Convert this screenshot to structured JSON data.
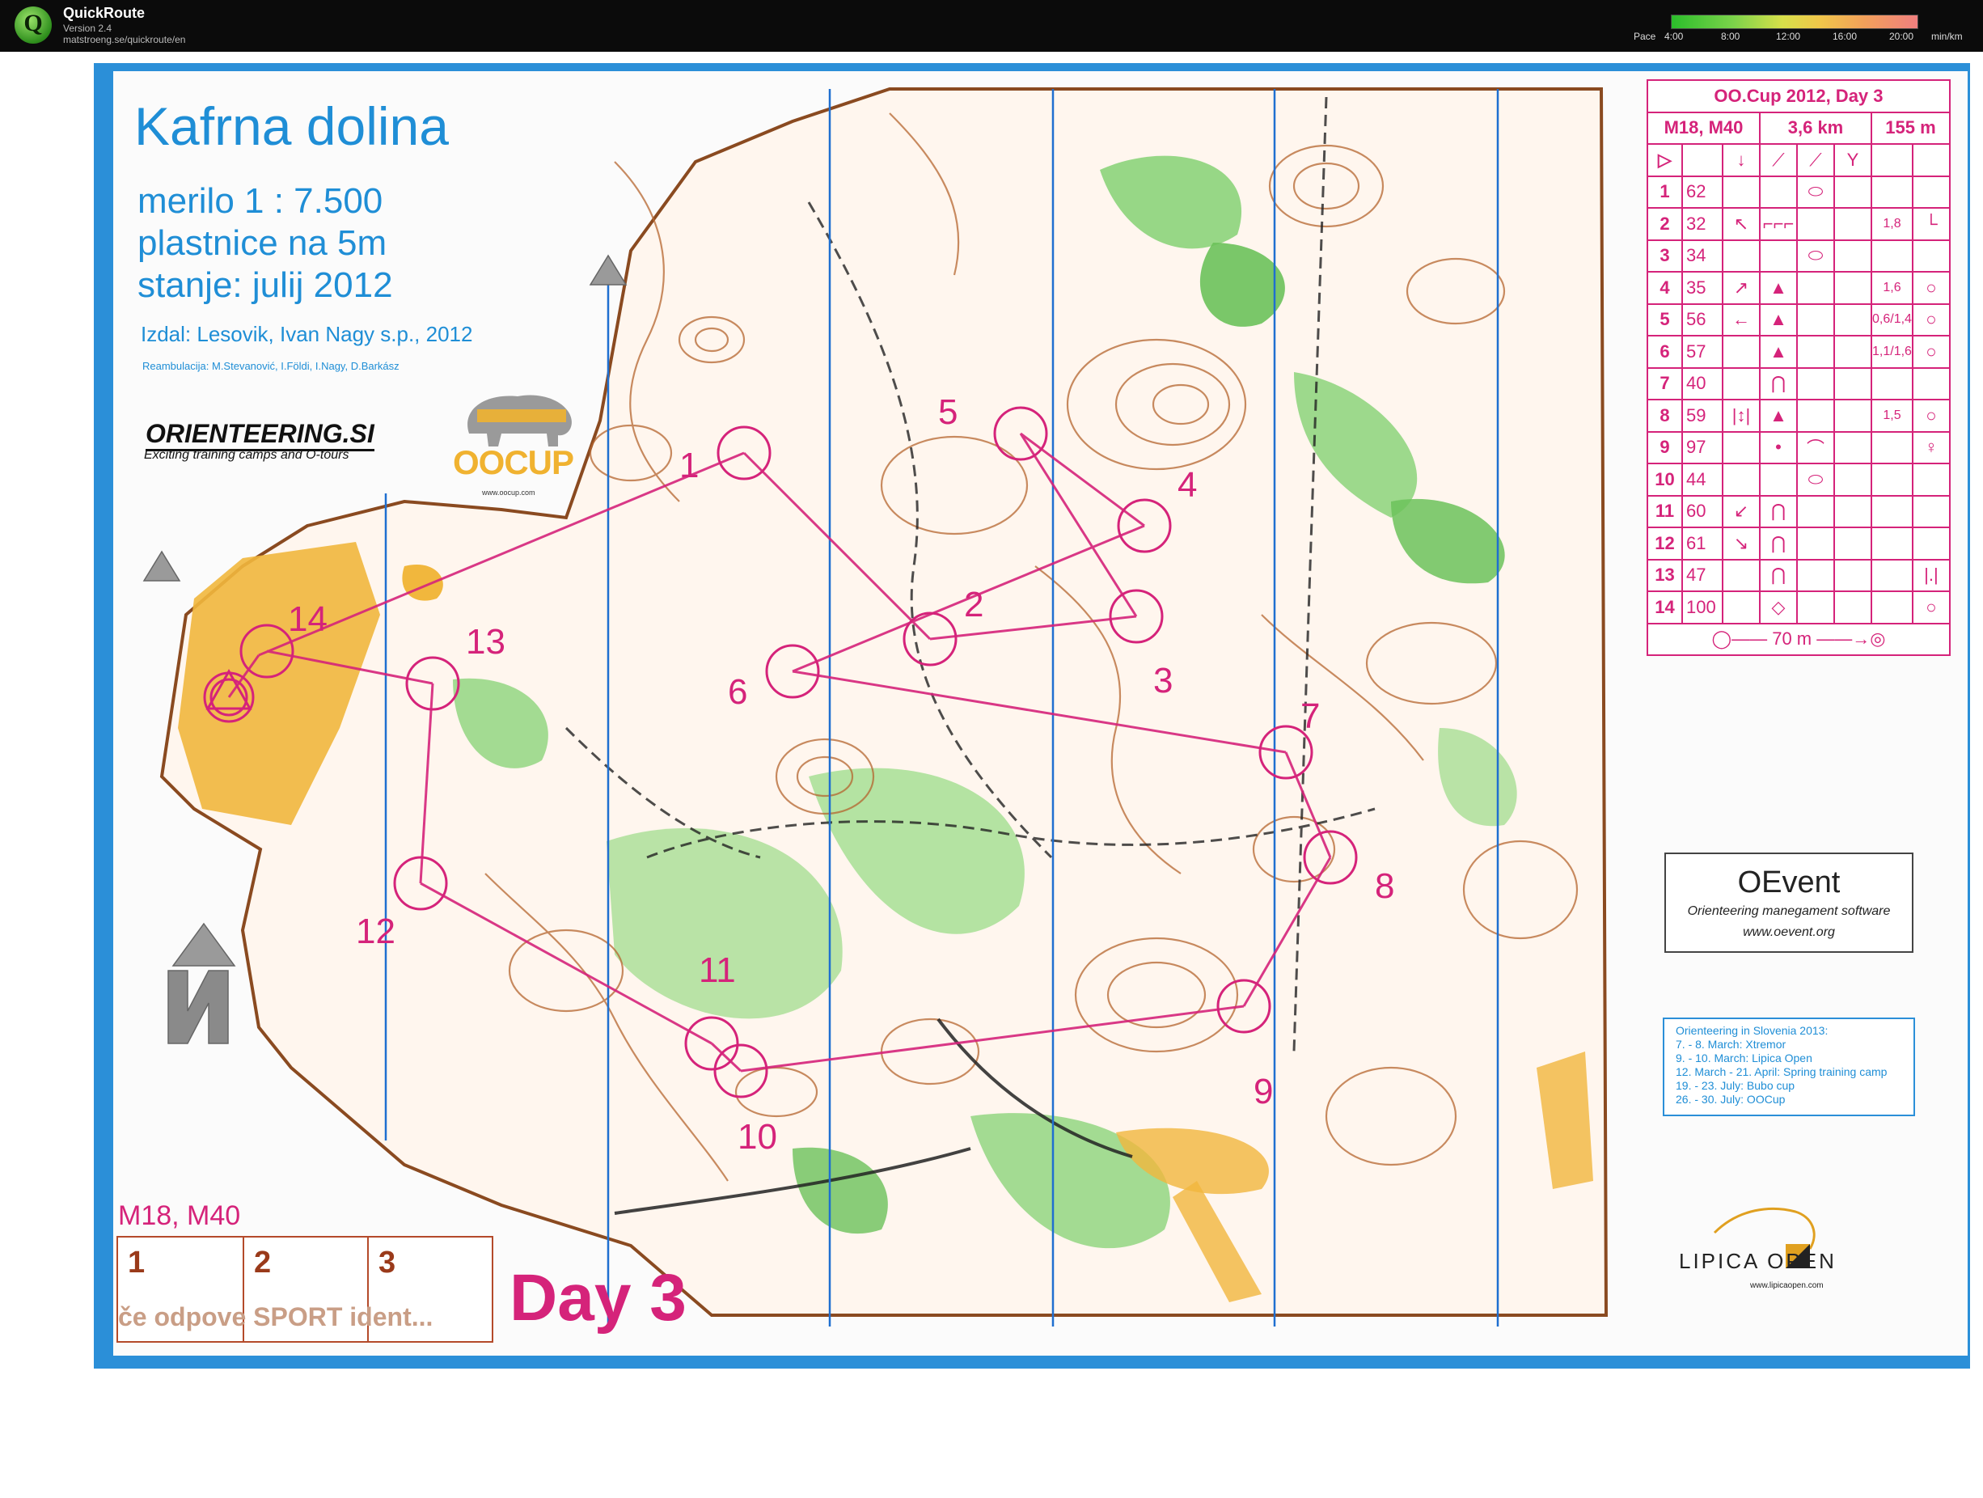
{
  "app": {
    "title": "QuickRoute",
    "version": "Version 2.4",
    "url": "matstroeng.se/quickroute/en",
    "logo_letter": "Q",
    "pace_label": "Pace",
    "pace_ticks": [
      "4:00",
      "8:00",
      "12:00",
      "16:00",
      "20:00"
    ],
    "pace_unit": "min/km"
  },
  "map": {
    "title": "Kafrna dolina",
    "scale": "merilo 1 : 7.500",
    "contour": "plastnice na 5m",
    "state": "stanje: julij 2012",
    "publisher": "Izdal: Lesovik, Ivan Nagy s.p., 2012",
    "reambulation": "Reambulacija: M.Stevanović, I.Földi, I.Nagy, D.Barkász",
    "class_label": "M18, M40",
    "punch_boxes": [
      "1",
      "2",
      "3"
    ],
    "punch_note": "če odpove SPORT ident...",
    "day_label": "Day 3",
    "control_labels": [
      "1",
      "2",
      "3",
      "4",
      "5",
      "6",
      "7",
      "8",
      "9",
      "10",
      "11",
      "12",
      "13",
      "14"
    ]
  },
  "sponsors": {
    "orienteering": "ORIENTEERING.SI",
    "orienteering_sub": "Exciting training camps and O-tours",
    "oocup": "OOCUP",
    "oocup_url": "www.oocup.com",
    "oevent_title": "OEvent",
    "oevent_sub": "Orienteering manegament software",
    "oevent_url": "www.oevent.org",
    "lipica": "LIPICA OPEN",
    "lipica_url": "www.lipicaopen.com"
  },
  "events": {
    "heading": "Orienteering in Slovenia 2013:",
    "items": [
      "7. - 8. March: Xtremor",
      "9. - 10. March: Lipica Open",
      "12. March - 21. April: Spring training camp",
      "19. - 23. July: Bubo cup",
      "26. - 30. July: OOCup"
    ]
  },
  "control_description": {
    "event": "OO.Cup 2012, Day 3",
    "classes": "M18, M40",
    "length": "3,6 km",
    "climb": "155 m",
    "finish_distance": "70 m",
    "rows": [
      {
        "num": "1",
        "code": "62",
        "dir": "",
        "feat": "",
        "detail": "knoll",
        "dim": "",
        "pos": ""
      },
      {
        "num": "2",
        "code": "32",
        "dir": "↖",
        "feat": "⌐⌐⌐",
        "detail": "",
        "dim": "1,8",
        "pos": "└"
      },
      {
        "num": "3",
        "code": "34",
        "dir": "",
        "feat": "",
        "detail": "knoll",
        "dim": "",
        "pos": ""
      },
      {
        "num": "4",
        "code": "35",
        "dir": "↗",
        "feat": "▲",
        "detail": "",
        "dim": "1,6",
        "pos": "○"
      },
      {
        "num": "5",
        "code": "56",
        "dir": "←",
        "feat": "▲",
        "detail": "",
        "dim": "0,6/1,4",
        "pos": "○"
      },
      {
        "num": "6",
        "code": "57",
        "dir": "",
        "feat": "▲",
        "detail": "",
        "dim": "1,1/1,6",
        "pos": "○"
      },
      {
        "num": "7",
        "code": "40",
        "dir": "",
        "feat": "⋂",
        "detail": "",
        "dim": "",
        "pos": ""
      },
      {
        "num": "8",
        "code": "59",
        "dir": "|↕|",
        "feat": "▲",
        "detail": "",
        "dim": "1,5",
        "pos": "○"
      },
      {
        "num": "9",
        "code": "97",
        "dir": "",
        "feat": "•",
        "detail": "⌒",
        "dim": "",
        "pos": "♀"
      },
      {
        "num": "10",
        "code": "44",
        "dir": "",
        "feat": "",
        "detail": "knoll",
        "dim": "",
        "pos": ""
      },
      {
        "num": "11",
        "code": "60",
        "dir": "↙",
        "feat": "⋂",
        "detail": "",
        "dim": "",
        "pos": ""
      },
      {
        "num": "12",
        "code": "61",
        "dir": "↘",
        "feat": "⋂",
        "detail": "",
        "dim": "",
        "pos": ""
      },
      {
        "num": "13",
        "code": "47",
        "dir": "",
        "feat": "⋂",
        "detail": "",
        "dim": "",
        "pos": "|.|"
      },
      {
        "num": "14",
        "code": "100",
        "dir": "",
        "feat": "◇",
        "detail": "",
        "dim": "",
        "pos": "○"
      }
    ]
  },
  "colors": {
    "frame_blue": "#2b8fd8",
    "course_magenta": "#d5237a",
    "contour_brown": "#b5652f",
    "vegetation_green": "#7fcf6a",
    "open_yellow": "#f1b73d"
  }
}
